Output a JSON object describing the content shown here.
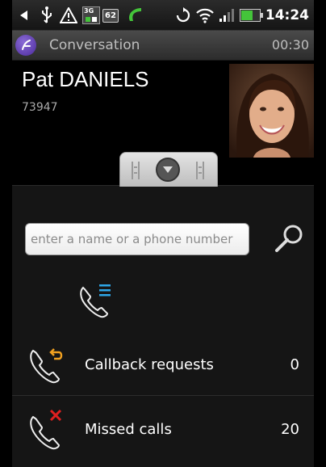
{
  "status_bar": {
    "network_label": "3G",
    "battery_percent": "62",
    "time": "14:24"
  },
  "app_bar": {
    "title": "Conversation",
    "call_duration": "00:30"
  },
  "contact": {
    "name": "Pat DANIELS",
    "number": "73947"
  },
  "search": {
    "placeholder": "enter a name or a phone number"
  },
  "rows": [
    {
      "label": "Callback requests",
      "count": "0",
      "icon": "phone-callback-icon"
    },
    {
      "label": "Missed calls",
      "count": "20",
      "icon": "phone-missed-icon"
    }
  ],
  "colors": {
    "accent_blue": "#2ea6e8",
    "callback_orange": "#f0a020",
    "missed_red": "#e02020",
    "call_green": "#44c43a"
  }
}
